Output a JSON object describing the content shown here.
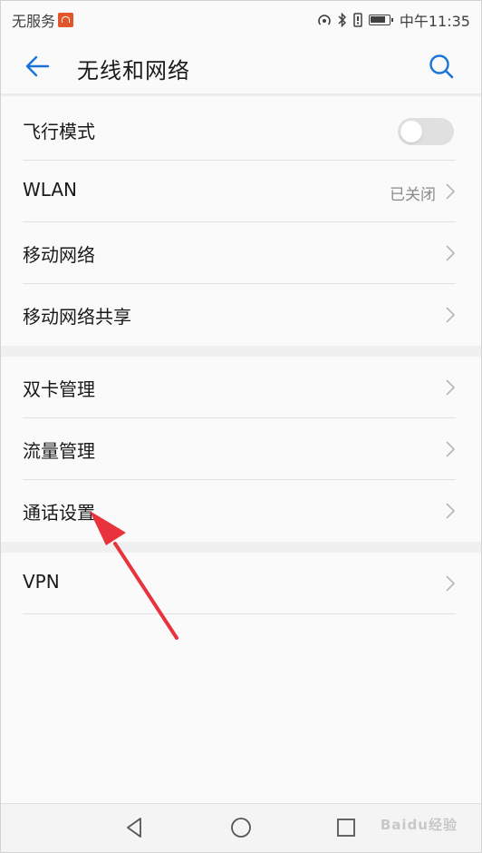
{
  "status_bar": {
    "carrier": "无服务",
    "time": "中午11:35"
  },
  "header": {
    "title": "无线和网络"
  },
  "sections": [
    {
      "items": [
        {
          "label": "飞行模式",
          "type": "toggle",
          "toggle_on": false
        },
        {
          "label": "WLAN",
          "type": "link",
          "value": "已关闭"
        },
        {
          "label": "移动网络",
          "type": "link"
        },
        {
          "label": "移动网络共享",
          "type": "link"
        }
      ]
    },
    {
      "items": [
        {
          "label": "双卡管理",
          "type": "link"
        },
        {
          "label": "流量管理",
          "type": "link"
        },
        {
          "label": "通话设置",
          "type": "link"
        }
      ]
    },
    {
      "items": [
        {
          "label": "VPN",
          "type": "link"
        }
      ]
    }
  ],
  "watermark": "Baidu经验",
  "colors": {
    "accent": "#1a73d9",
    "annotation_arrow": "#e8323c",
    "background": "#fafafa",
    "section_gap": "#f0f0f0"
  }
}
